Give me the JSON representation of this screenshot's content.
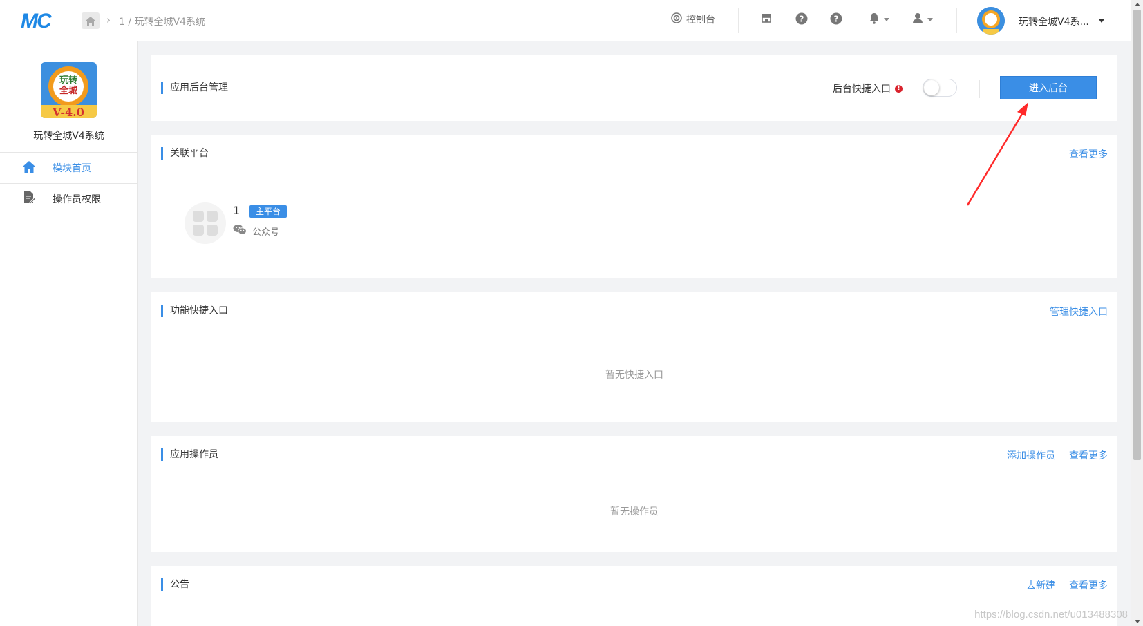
{
  "header": {
    "logo_text": "MC",
    "breadcrumb": "1 / 玩转全城V4系统",
    "console_label": "控制台",
    "user_name": "玩转全城V4系...",
    "icons": [
      "home-icon",
      "target-icon",
      "store-icon",
      "help-icon",
      "help-icon",
      "bell-icon",
      "user-icon"
    ]
  },
  "sidebar": {
    "app_name": "玩转全城V4系统",
    "logo_text_top": "玩转",
    "logo_text_mid": "全城",
    "logo_version": "V-4.0",
    "items": [
      {
        "label": "模块首页",
        "icon": "home-icon",
        "active": true
      },
      {
        "label": "操作员权限",
        "icon": "edit-doc-icon",
        "active": false
      }
    ]
  },
  "cards": {
    "backend": {
      "title": "应用后台管理",
      "quick_entry_label": "后台快捷入口",
      "toggle_on": false,
      "enter_button": "进入后台"
    },
    "platforms": {
      "title": "关联平台",
      "more_link": "查看更多",
      "item": {
        "name": "1",
        "badge": "主平台",
        "type": "公众号"
      }
    },
    "shortcuts": {
      "title": "功能快捷入口",
      "manage_link": "管理快捷入口",
      "empty_text": "暂无快捷入口"
    },
    "operators": {
      "title": "应用操作员",
      "add_link": "添加操作员",
      "more_link": "查看更多",
      "empty_text": "暂无操作员"
    },
    "notices": {
      "title": "公告",
      "new_link": "去新建",
      "more_link": "查看更多"
    }
  },
  "watermark": "https://blog.csdn.net/u013488308",
  "colors": {
    "accent": "#3a8ee6",
    "arrow": "#ff2a2a",
    "badge_red": "#d9232d"
  }
}
